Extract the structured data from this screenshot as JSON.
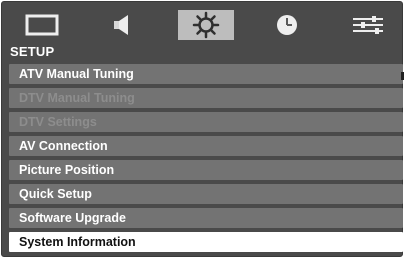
{
  "tabs": [
    {
      "icon": "picture-icon",
      "active": false
    },
    {
      "icon": "sound-icon",
      "active": false
    },
    {
      "icon": "setup-gear-icon",
      "active": true
    },
    {
      "icon": "timer-clock-icon",
      "active": false
    },
    {
      "icon": "preferences-sliders-icon",
      "active": false
    }
  ],
  "section_title": "SETUP",
  "menu": {
    "items": [
      {
        "label": "ATV Manual Tuning",
        "state": "normal"
      },
      {
        "label": "DTV Manual Tuning",
        "state": "disabled"
      },
      {
        "label": "DTV Settings",
        "state": "disabled"
      },
      {
        "label": "AV Connection",
        "state": "normal"
      },
      {
        "label": "Picture Position",
        "state": "normal"
      },
      {
        "label": "Quick Setup",
        "state": "normal"
      },
      {
        "label": "Software Upgrade",
        "state": "normal"
      },
      {
        "label": "System Information",
        "state": "selected"
      }
    ]
  },
  "colors": {
    "panel": "#4a4a4a",
    "item": "#737373",
    "active_tab": "#bdbdbd",
    "selected_item": "#ffffff"
  }
}
